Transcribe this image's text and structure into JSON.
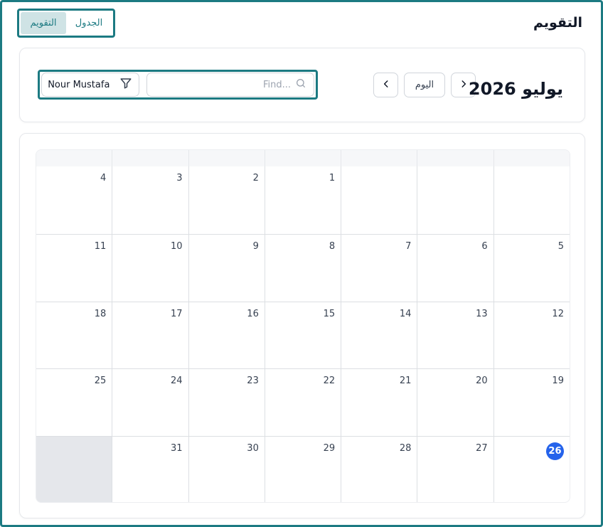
{
  "page": {
    "title": "التقويم"
  },
  "view_toggle": {
    "calendar_label": "التقويم",
    "table_label": "الجدول",
    "active": "calendar"
  },
  "toolbar": {
    "month_title": "يوليو 2026",
    "today_label": "اليوم",
    "filter_label": "Nour Mustafa",
    "search_placeholder": "Find..."
  },
  "calendar": {
    "weeks": [
      [
        "4",
        "3",
        "2",
        "1",
        "",
        "",
        ""
      ],
      [
        "11",
        "10",
        "9",
        "8",
        "7",
        "6",
        "5"
      ],
      [
        "18",
        "17",
        "16",
        "15",
        "14",
        "13",
        "12"
      ],
      [
        "25",
        "24",
        "23",
        "22",
        "21",
        "20",
        "19"
      ],
      [
        "",
        "31",
        "30",
        "29",
        "28",
        "27",
        "26"
      ]
    ],
    "today": "26"
  },
  "colors": {
    "accent": "#1c7a82",
    "today": "#2563eb"
  }
}
